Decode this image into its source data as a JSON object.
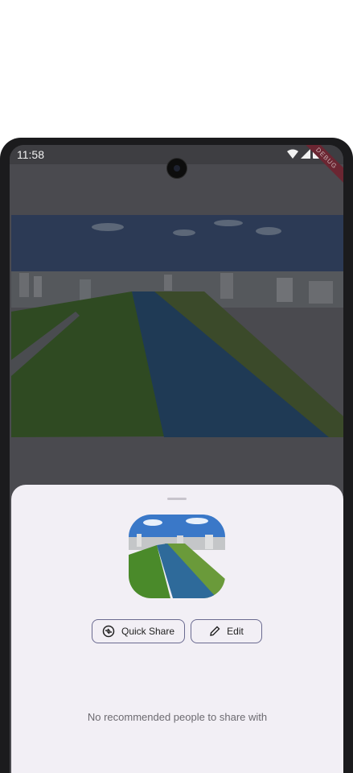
{
  "status_bar": {
    "time": "11:58",
    "icons": [
      "wifi-icon",
      "signal-icon",
      "battery-icon"
    ],
    "debug_banner": "DEBUG"
  },
  "content": {
    "image_description_icon": "photo-river-city"
  },
  "share_sheet": {
    "quick_share_label": "Quick Share",
    "edit_label": "Edit",
    "empty_message": "No recommended people to share with"
  },
  "colors": {
    "sheet_background": "#f2eff5",
    "button_border": "#6a6a90",
    "scrim": "#4a4a4f"
  }
}
